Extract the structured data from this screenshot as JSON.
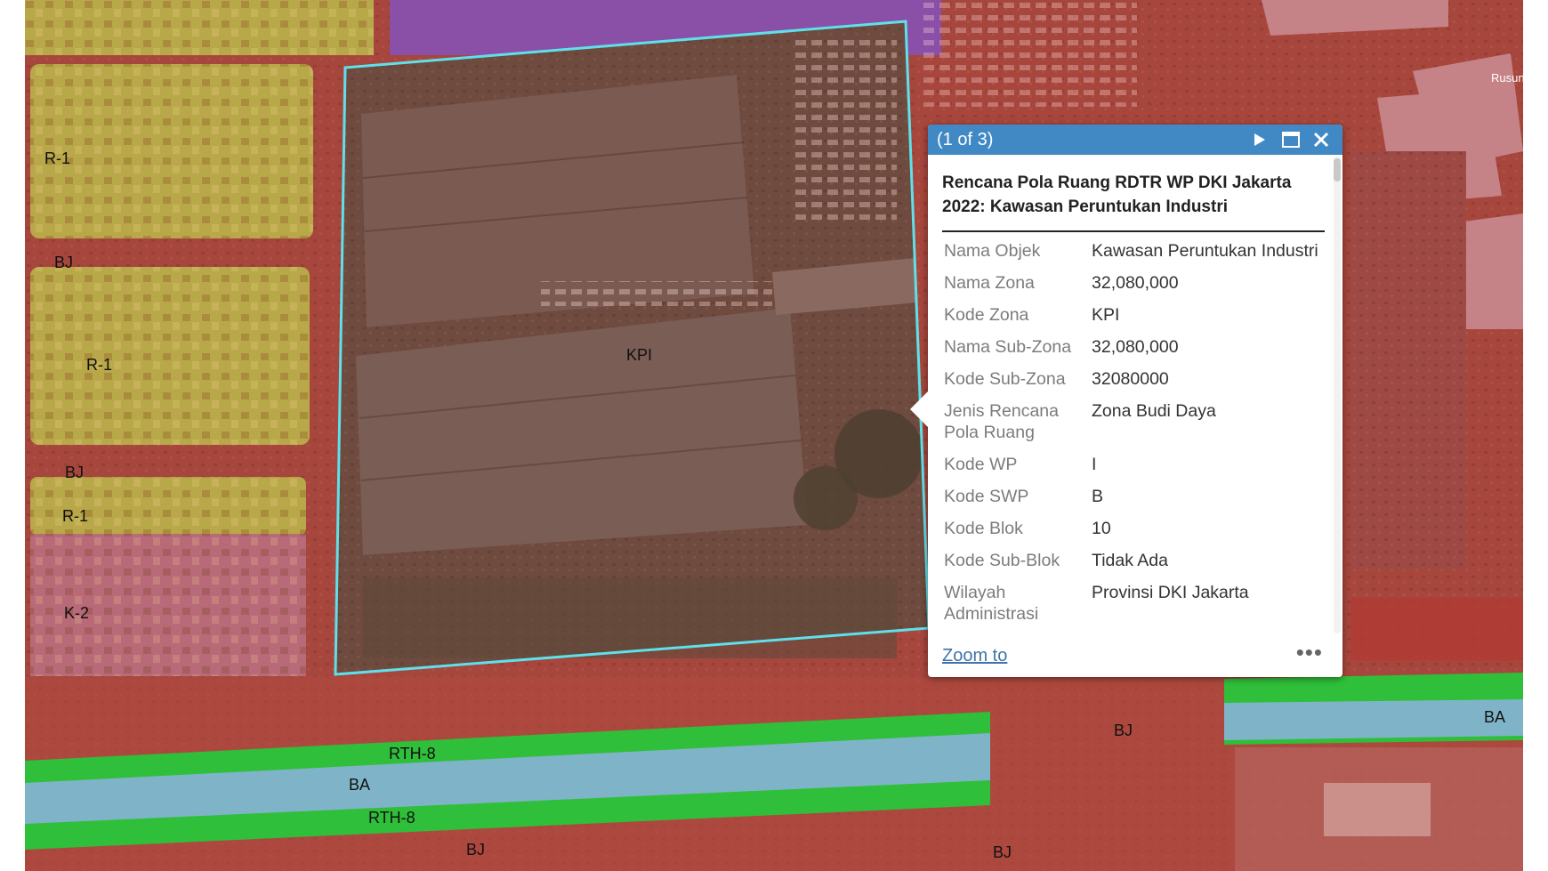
{
  "map": {
    "zone_labels": [
      {
        "id": "r1-a",
        "text": "R-1"
      },
      {
        "id": "bj-a",
        "text": "BJ"
      },
      {
        "id": "r1-b",
        "text": "R-1"
      },
      {
        "id": "bj-b",
        "text": "BJ"
      },
      {
        "id": "r1-c",
        "text": "R-1"
      },
      {
        "id": "k2",
        "text": "K-2"
      },
      {
        "id": "kpi",
        "text": "KPI"
      },
      {
        "id": "rth8-a",
        "text": "RTH-8"
      },
      {
        "id": "ba-a",
        "text": "BA"
      },
      {
        "id": "rth8-b",
        "text": "RTH-8"
      },
      {
        "id": "bj-c",
        "text": "BJ"
      },
      {
        "id": "bj-d",
        "text": "BJ"
      },
      {
        "id": "bj-e",
        "text": "BJ"
      },
      {
        "id": "ba-b",
        "text": "BA"
      }
    ],
    "edge_label": "Rusun",
    "colors": {
      "industrial_red": "#a7463c",
      "residential_yellow": "#b9a84a",
      "commercial_pink": "#b86a78",
      "green_space": "#2fbf3a",
      "water_blue": "#7fb4c8",
      "purple_zone": "#8a4fa6",
      "selection_cyan": "#5fe0ea"
    }
  },
  "popup": {
    "counter": "(1 of 3)",
    "title": "Rencana Pola Ruang RDTR WP DKI Jakarta 2022: Kawasan Peruntukan Industri",
    "fields": [
      {
        "label": "Nama Objek",
        "value": "Kawasan Peruntukan Industri"
      },
      {
        "label": "Nama Zona",
        "value": "32,080,000"
      },
      {
        "label": "Kode Zona",
        "value": "KPI"
      },
      {
        "label": "Nama Sub-Zona",
        "value": "32,080,000"
      },
      {
        "label": "Kode Sub-Zona",
        "value": "32080000"
      },
      {
        "label": "Jenis Rencana Pola Ruang",
        "value": "Zona Budi Daya"
      },
      {
        "label": "Kode WP",
        "value": "I"
      },
      {
        "label": "Kode SWP",
        "value": "B"
      },
      {
        "label": "Kode Blok",
        "value": "10"
      },
      {
        "label": "Kode Sub-Blok",
        "value": "Tidak Ada"
      },
      {
        "label": "Wilayah Administrasi",
        "value": "Provinsi DKI Jakarta"
      }
    ],
    "zoom_link": "Zoom to",
    "more": "•••",
    "icons": {
      "next": "play-icon",
      "maximize": "maximize-icon",
      "close": "close-icon",
      "more": "ellipsis-icon"
    }
  }
}
